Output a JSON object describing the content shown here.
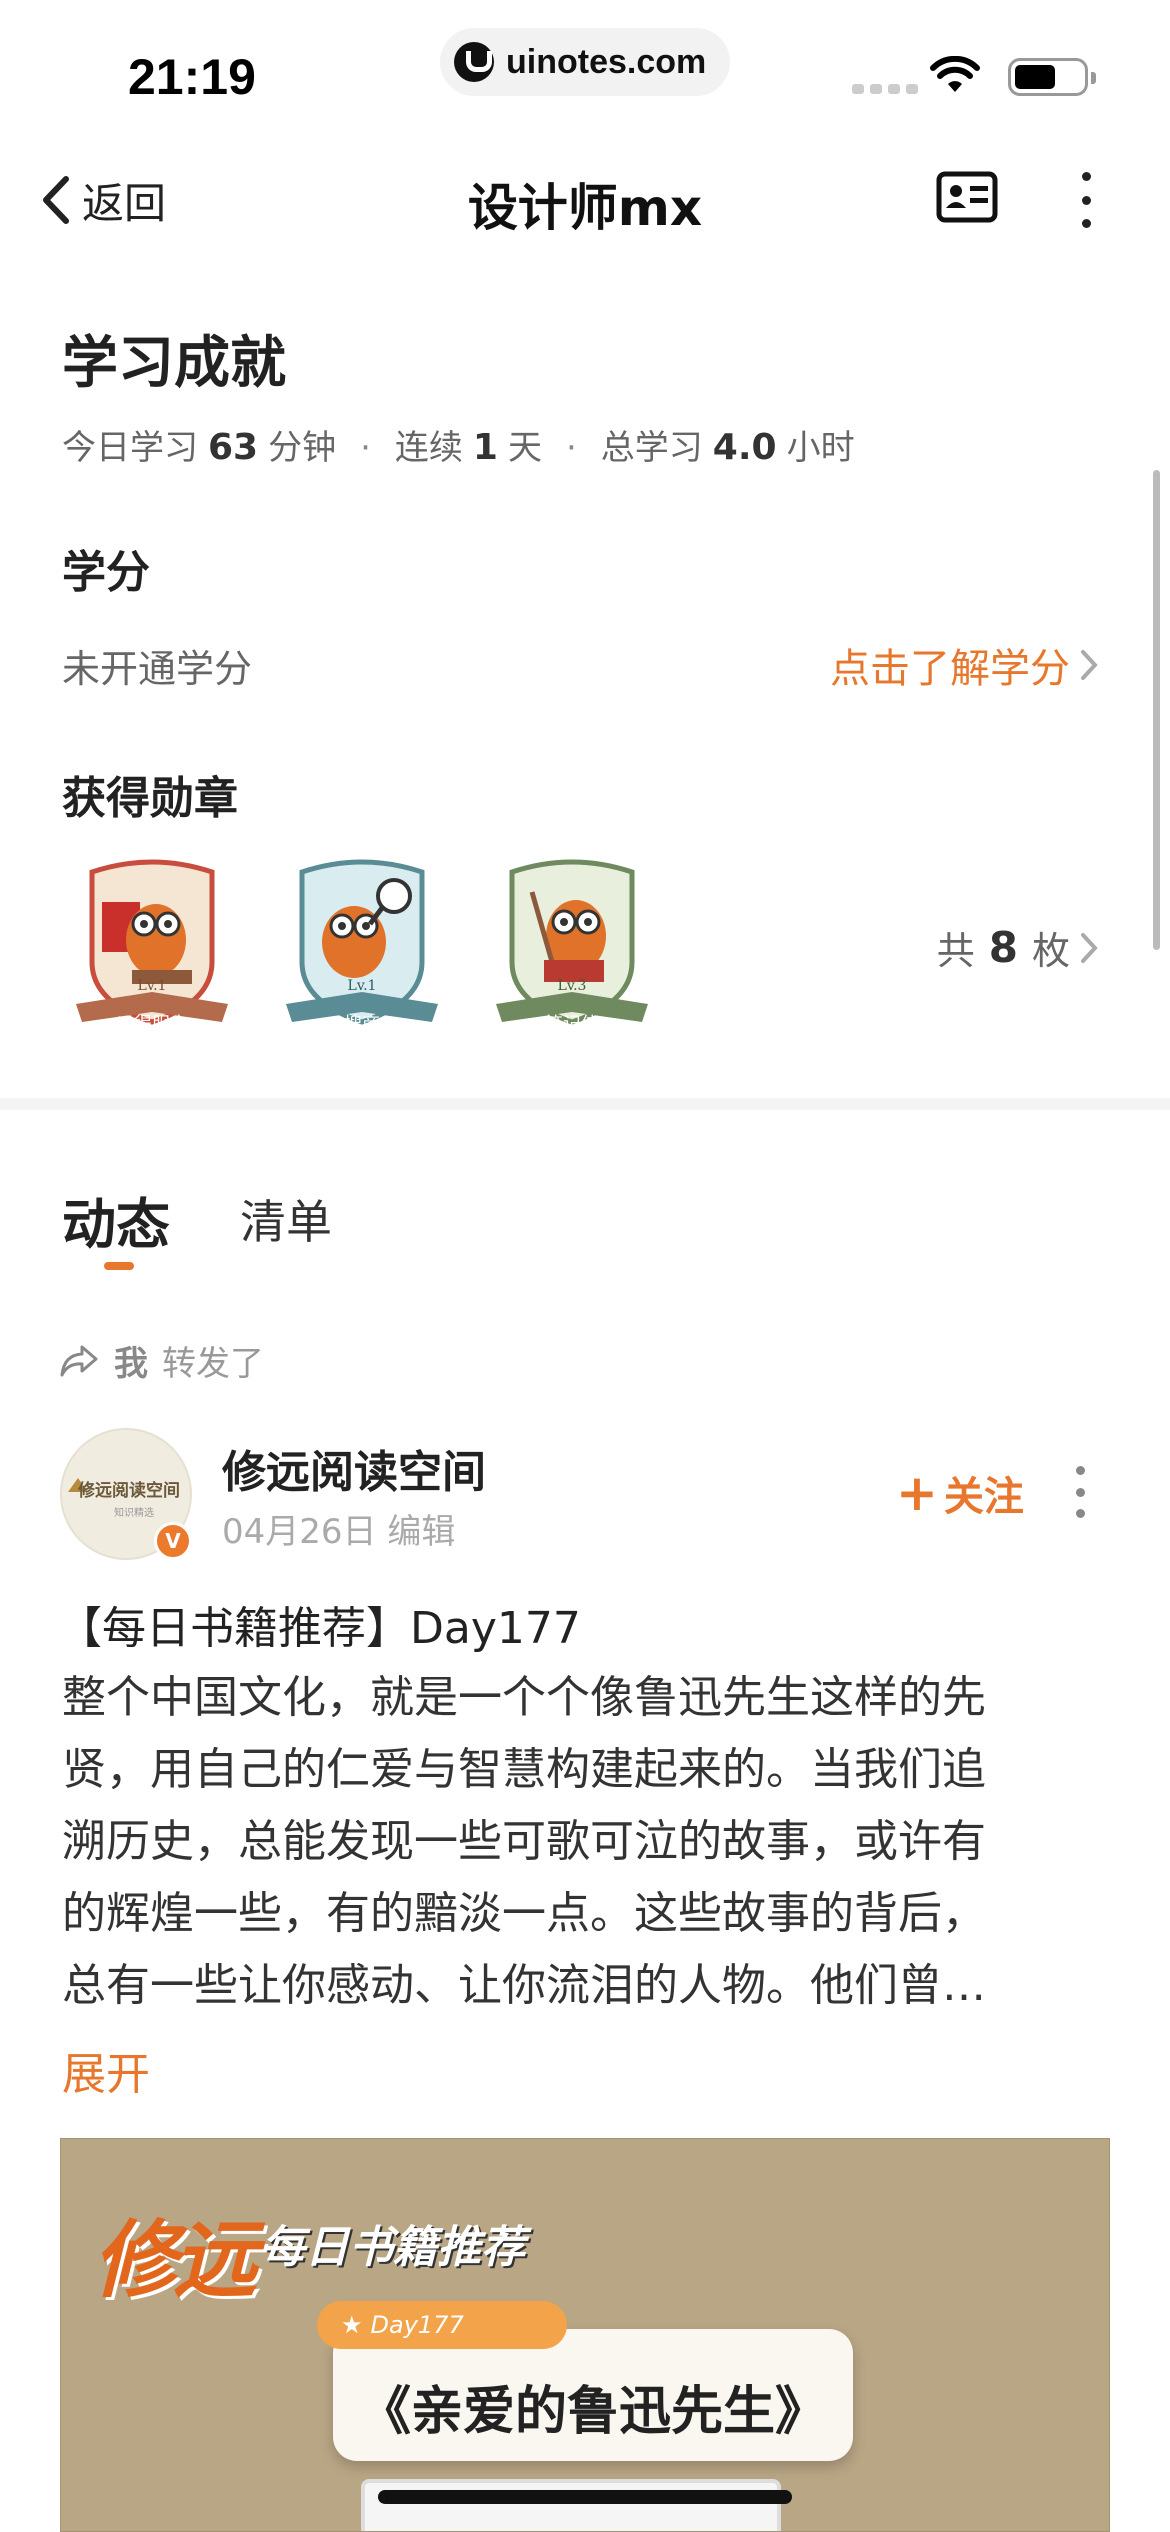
{
  "status_bar": {
    "time": "21:19",
    "url": "uinotes.com"
  },
  "nav": {
    "back_label": "返回",
    "title": "设计师mx"
  },
  "achievements": {
    "title": "学习成就",
    "stats": {
      "today_prefix": "今日学习",
      "today_value": "63",
      "today_unit": "分钟",
      "streak_prefix": "连续",
      "streak_value": "1",
      "streak_unit": "天",
      "total_prefix": "总学习",
      "total_value": "4.0",
      "total_unit": "小时",
      "separator": "·"
    },
    "credits": {
      "title": "学分",
      "status": "未开通学分",
      "link": "点击了解学分"
    },
    "medals": {
      "title": "获得勋章",
      "items": [
        {
          "level": "Lv.1",
          "label": "以得服人"
        },
        {
          "level": "Lv.1",
          "label": "搜商"
        },
        {
          "level": "Lv.3",
          "label": "笔记侠"
        }
      ],
      "count_prefix": "共",
      "count_value": "8",
      "count_unit": "枚"
    }
  },
  "tabs": [
    {
      "label": "动态",
      "active": true
    },
    {
      "label": "清单",
      "active": false
    }
  ],
  "feed": {
    "repost_user": "我",
    "repost_action": "转发了",
    "author": {
      "name": "修远阅读空间",
      "avatar_text": "修远阅读空间",
      "avatar_sub": "知识精选",
      "verified_mark": "V"
    },
    "meta": "04月26日 编辑",
    "follow_label": "关注",
    "post_title": "【每日书籍推荐】Day177",
    "post_lines": [
      "整个中国文化，就是一个个像鲁迅先生这样的先",
      "贤，用自己的仁爱与智慧构建起来的。当我们追",
      "溯历史，总能发现一些可歌可泣的故事，或许有",
      "的辉煌一些，有的黯淡一点。这些故事的背后，",
      "总有一些让你感动、让你流泪的人物。他们曾…"
    ],
    "expand_label": "展开",
    "image": {
      "brand": "修远",
      "subtitle": "每日书籍推荐",
      "day_tag": "Day177",
      "book_title": "《亲爱的鲁迅先生》"
    }
  },
  "colors": {
    "accent": "#e8772e",
    "text_primary": "#222222",
    "text_secondary": "#666666"
  }
}
